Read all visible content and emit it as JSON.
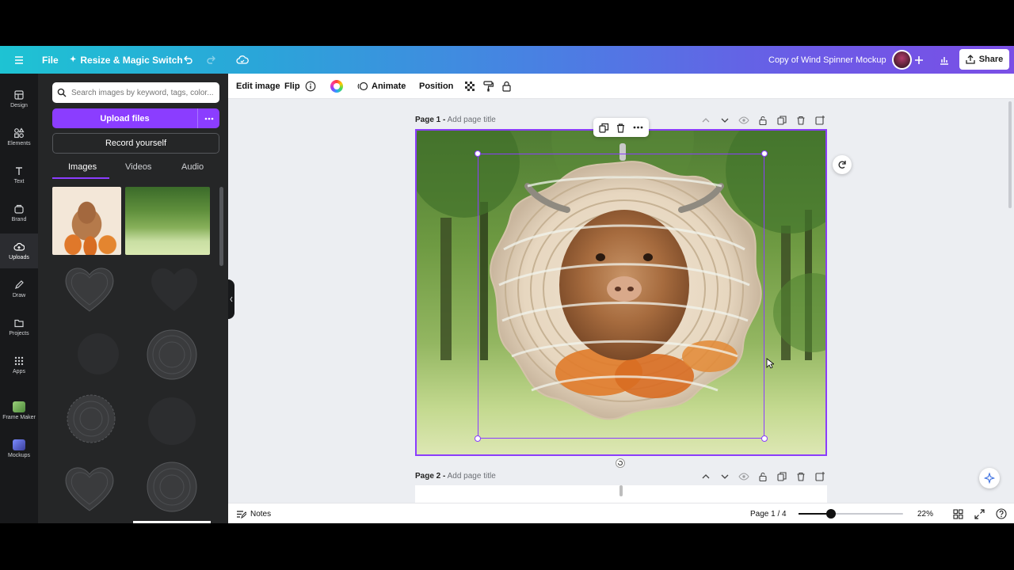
{
  "topbar": {
    "file_label": "File",
    "resize_label": "Resize & Magic Switch",
    "doc_title": "Copy of Wind Spinner Mockup",
    "share_label": "Share"
  },
  "rail": {
    "items": [
      {
        "label": "Design",
        "icon": "layout-icon"
      },
      {
        "label": "Elements",
        "icon": "shapes-icon"
      },
      {
        "label": "Text",
        "icon": "text-icon"
      },
      {
        "label": "Brand",
        "icon": "brand-icon"
      },
      {
        "label": "Uploads",
        "icon": "cloud-upload-icon"
      },
      {
        "label": "Draw",
        "icon": "pen-icon"
      },
      {
        "label": "Projects",
        "icon": "folder-icon"
      },
      {
        "label": "Apps",
        "icon": "grid-icon"
      },
      {
        "label": "Frame Maker",
        "icon": "frame-maker-app-icon"
      },
      {
        "label": "Mockups",
        "icon": "mockups-app-icon"
      }
    ]
  },
  "panel": {
    "search_placeholder": "Search images by keyword, tags, color...",
    "upload_label": "Upload files",
    "record_label": "Record yourself",
    "tabs": [
      "Images",
      "Videos",
      "Audio"
    ]
  },
  "ctxbar": {
    "edit_image": "Edit image",
    "flip": "Flip",
    "animate": "Animate",
    "position": "Position"
  },
  "pages": [
    {
      "label": "Page 1 -",
      "title_placeholder": "Add page title"
    },
    {
      "label": "Page 2 -",
      "title_placeholder": "Add page title"
    }
  ],
  "bottombar": {
    "notes_label": "Notes",
    "page_indicator": "Page 1 / 4",
    "zoom": "22%",
    "zoom_fraction": 0.22
  },
  "colors": {
    "accent": "#8b3dff",
    "rail_bg": "#18191b",
    "panel_bg": "#252627"
  }
}
